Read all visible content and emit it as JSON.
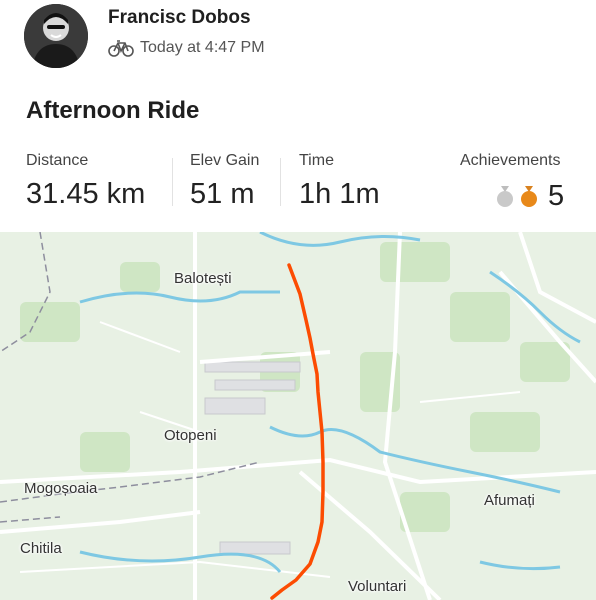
{
  "athlete": {
    "name": "Francisc Dobos",
    "activity_type_icon": "bike-icon",
    "timestamp": "Today at 4:47 PM"
  },
  "activity": {
    "title": "Afternoon Ride"
  },
  "stats": {
    "distance": {
      "label": "Distance",
      "value": "31.45 km"
    },
    "elev_gain": {
      "label": "Elev Gain",
      "value": "51 m"
    },
    "time": {
      "label": "Time",
      "value": "1h 1m"
    },
    "achievements": {
      "label": "Achievements",
      "count": "5",
      "icons": [
        "silver-medal-icon",
        "bronze-medal-icon"
      ]
    }
  },
  "map": {
    "places": [
      "Balotești",
      "Otopeni",
      "Mogoșoaia",
      "Chitila",
      "Afumați",
      "Voluntari"
    ],
    "route_color": "#fc4c02"
  },
  "colors": {
    "accent": "#fc4c02",
    "map_bg": "#e8f1e4",
    "water": "#7ec8e3"
  }
}
